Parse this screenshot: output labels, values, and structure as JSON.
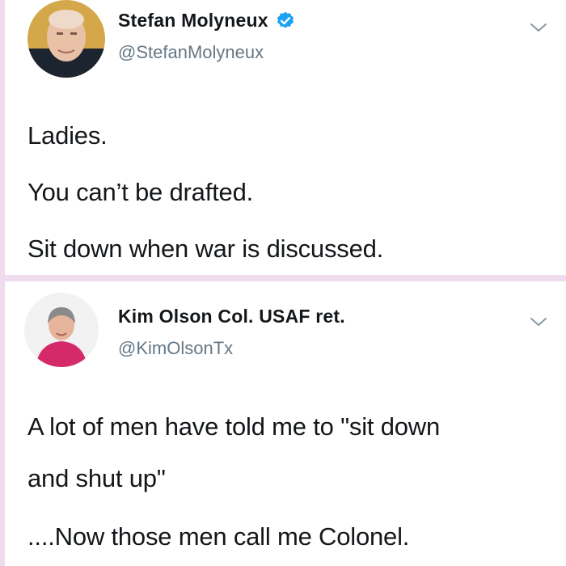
{
  "tweets": [
    {
      "display_name": "Stefan Molyneux",
      "handle": "@StefanMolyneux",
      "verified": true,
      "body_lines": [
        "Ladies.",
        "You can’t be drafted.",
        "Sit down when war is discussed."
      ]
    },
    {
      "display_name": "Kim Olson Col. USAF ret.",
      "handle": "@KimOlsonTx",
      "verified": false,
      "body_lines": [
        "A lot of men have told me to \"sit down",
        "and shut up\"",
        "....Now those men call me Colonel."
      ]
    }
  ],
  "colors": {
    "verified_blue": "#1da1f2",
    "handle_gray": "#657786",
    "text": "#14171a",
    "background": "#efdcef"
  },
  "icons": [
    "verified-badge-icon",
    "chevron-down-icon"
  ]
}
